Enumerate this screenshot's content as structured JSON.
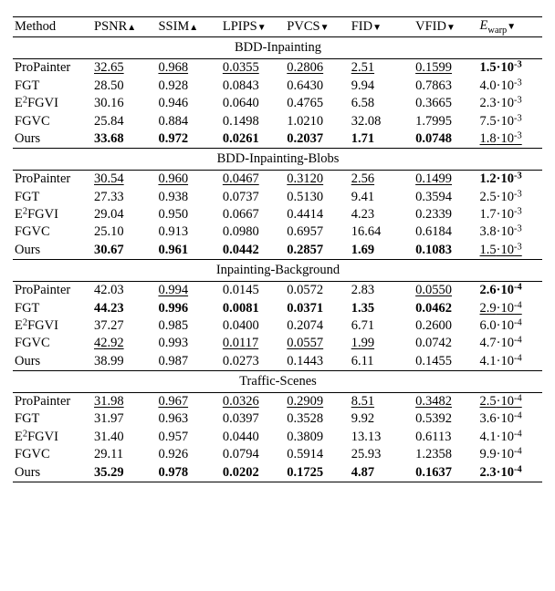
{
  "chart_data": {
    "type": "table",
    "columns": [
      "Method",
      "PSNR",
      "SSIM",
      "LPIPS",
      "PVCS",
      "FID",
      "VFID",
      "E_warp"
    ],
    "directions": [
      "",
      "up",
      "up",
      "down",
      "down",
      "down",
      "down",
      "down"
    ],
    "sections": [
      {
        "title": "BDD-Inpainting",
        "rows": [
          {
            "method": "ProPainter",
            "psnr": "32.65",
            "ssim": "0.968",
            "lpips": "0.0355",
            "pvcs": "0.2806",
            "fid": "2.51",
            "vfid": "0.1599",
            "ewarp_m": "1.5",
            "ewarp_e": "-3",
            "best": [
              "ewarp"
            ],
            "second": [
              "psnr",
              "ssim",
              "lpips",
              "pvcs",
              "fid",
              "vfid"
            ]
          },
          {
            "method": "FGT",
            "psnr": "28.50",
            "ssim": "0.928",
            "lpips": "0.0843",
            "pvcs": "0.6430",
            "fid": "9.94",
            "vfid": "0.7863",
            "ewarp_m": "4.0",
            "ewarp_e": "-3"
          },
          {
            "method": "E2FGVI",
            "psnr": "30.16",
            "ssim": "0.946",
            "lpips": "0.0640",
            "pvcs": "0.4765",
            "fid": "6.58",
            "vfid": "0.3665",
            "ewarp_m": "2.3",
            "ewarp_e": "-3"
          },
          {
            "method": "FGVC",
            "psnr": "25.84",
            "ssim": "0.884",
            "lpips": "0.1498",
            "pvcs": "1.0210",
            "fid": "32.08",
            "vfid": "1.7995",
            "ewarp_m": "7.5",
            "ewarp_e": "-3"
          },
          {
            "method": "Ours",
            "psnr": "33.68",
            "ssim": "0.972",
            "lpips": "0.0261",
            "pvcs": "0.2037",
            "fid": "1.71",
            "vfid": "0.0748",
            "ewarp_m": "1.8",
            "ewarp_e": "-3",
            "best": [
              "psnr",
              "ssim",
              "lpips",
              "pvcs",
              "fid",
              "vfid"
            ],
            "second": [
              "ewarp"
            ]
          }
        ]
      },
      {
        "title": "BDD-Inpainting-Blobs",
        "rows": [
          {
            "method": "ProPainter",
            "psnr": "30.54",
            "ssim": "0.960",
            "lpips": "0.0467",
            "pvcs": "0.3120",
            "fid": "2.56",
            "vfid": "0.1499",
            "ewarp_m": "1.2",
            "ewarp_e": "-3",
            "best": [
              "ewarp"
            ],
            "second": [
              "psnr",
              "ssim",
              "lpips",
              "pvcs",
              "fid",
              "vfid"
            ]
          },
          {
            "method": "FGT",
            "psnr": "27.33",
            "ssim": "0.938",
            "lpips": "0.0737",
            "pvcs": "0.5130",
            "fid": "9.41",
            "vfid": "0.3594",
            "ewarp_m": "2.5",
            "ewarp_e": "-3"
          },
          {
            "method": "E2FGVI",
            "psnr": "29.04",
            "ssim": "0.950",
            "lpips": "0.0667",
            "pvcs": "0.4414",
            "fid": "4.23",
            "vfid": "0.2339",
            "ewarp_m": "1.7",
            "ewarp_e": "-3"
          },
          {
            "method": "FGVC",
            "psnr": "25.10",
            "ssim": "0.913",
            "lpips": "0.0980",
            "pvcs": "0.6957",
            "fid": "16.64",
            "vfid": "0.6184",
            "ewarp_m": "3.8",
            "ewarp_e": "-3"
          },
          {
            "method": "Ours",
            "psnr": "30.67",
            "ssim": "0.961",
            "lpips": "0.0442",
            "pvcs": "0.2857",
            "fid": "1.69",
            "vfid": "0.1083",
            "ewarp_m": "1.5",
            "ewarp_e": "-3",
            "best": [
              "psnr",
              "ssim",
              "lpips",
              "pvcs",
              "fid",
              "vfid"
            ],
            "second": [
              "ewarp"
            ]
          }
        ]
      },
      {
        "title": "Inpainting-Background",
        "rows": [
          {
            "method": "ProPainter",
            "psnr": "42.03",
            "ssim": "0.994",
            "lpips": "0.0145",
            "pvcs": "0.0572",
            "fid": "2.83",
            "vfid": "0.0550",
            "ewarp_m": "2.6",
            "ewarp_e": "-4",
            "best": [
              "ewarp"
            ],
            "second": [
              "ssim",
              "vfid"
            ]
          },
          {
            "method": "FGT",
            "psnr": "44.23",
            "ssim": "0.996",
            "lpips": "0.0081",
            "pvcs": "0.0371",
            "fid": "1.35",
            "vfid": "0.0462",
            "ewarp_m": "2.9",
            "ewarp_e": "-4",
            "best": [
              "psnr",
              "ssim",
              "lpips",
              "pvcs",
              "fid",
              "vfid"
            ],
            "second": [
              "ewarp"
            ]
          },
          {
            "method": "E2FGVI",
            "psnr": "37.27",
            "ssim": "0.985",
            "lpips": "0.0400",
            "pvcs": "0.2074",
            "fid": "6.71",
            "vfid": "0.2600",
            "ewarp_m": "6.0",
            "ewarp_e": "-4"
          },
          {
            "method": "FGVC",
            "psnr": "42.92",
            "ssim": "0.993",
            "lpips": "0.0117",
            "pvcs": "0.0557",
            "fid": "1.99",
            "vfid": "0.0742",
            "ewarp_m": "4.7",
            "ewarp_e": "-4",
            "second": [
              "psnr",
              "lpips",
              "pvcs",
              "fid"
            ]
          },
          {
            "method": "Ours",
            "psnr": "38.99",
            "ssim": "0.987",
            "lpips": "0.0273",
            "pvcs": "0.1443",
            "fid": "6.11",
            "vfid": "0.1455",
            "ewarp_m": "4.1",
            "ewarp_e": "-4"
          }
        ]
      },
      {
        "title": "Traffic-Scenes",
        "rows": [
          {
            "method": "ProPainter",
            "psnr": "31.98",
            "ssim": "0.967",
            "lpips": "0.0326",
            "pvcs": "0.2909",
            "fid": "8.51",
            "vfid": "0.3482",
            "ewarp_m": "2.5",
            "ewarp_e": "-4",
            "second": [
              "psnr",
              "ssim",
              "lpips",
              "pvcs",
              "fid",
              "vfid",
              "ewarp"
            ]
          },
          {
            "method": "FGT",
            "psnr": "31.97",
            "ssim": "0.963",
            "lpips": "0.0397",
            "pvcs": "0.3528",
            "fid": "9.92",
            "vfid": "0.5392",
            "ewarp_m": "3.6",
            "ewarp_e": "-4"
          },
          {
            "method": "E2FGVI",
            "psnr": "31.40",
            "ssim": "0.957",
            "lpips": "0.0440",
            "pvcs": "0.3809",
            "fid": "13.13",
            "vfid": "0.6113",
            "ewarp_m": "4.1",
            "ewarp_e": "-4"
          },
          {
            "method": "FGVC",
            "psnr": "29.11",
            "ssim": "0.926",
            "lpips": "0.0794",
            "pvcs": "0.5914",
            "fid": "25.93",
            "vfid": "1.2358",
            "ewarp_m": "9.9",
            "ewarp_e": "-4"
          },
          {
            "method": "Ours",
            "psnr": "35.29",
            "ssim": "0.978",
            "lpips": "0.0202",
            "pvcs": "0.1725",
            "fid": "4.87",
            "vfid": "0.1637",
            "ewarp_m": "2.3",
            "ewarp_e": "-4",
            "best": [
              "psnr",
              "ssim",
              "lpips",
              "pvcs",
              "fid",
              "vfid",
              "ewarp"
            ]
          }
        ]
      }
    ]
  },
  "headers": {
    "method": "Method",
    "psnr": "PSNR",
    "ssim": "SSIM",
    "lpips": "LPIPS",
    "pvcs": "PVCS",
    "fid": "FID",
    "vfid": "VFID",
    "ewarp_base": "E",
    "ewarp_sub": "warp"
  },
  "glyphs": {
    "up": "▲",
    "down": "▼",
    "dot": "·"
  },
  "methods_special": {
    "e2fgvi_prefix": "E",
    "e2fgvi_sup": "2",
    "e2fgvi_suffix": "FGVI"
  }
}
